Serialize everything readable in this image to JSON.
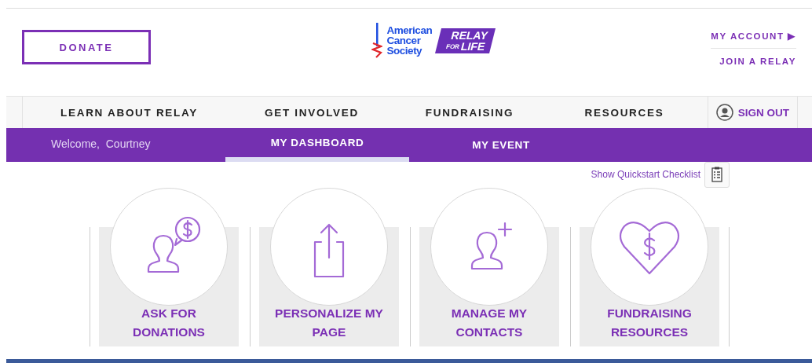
{
  "header": {
    "donate_button": "DONATE",
    "logo": {
      "org_lines": [
        "American",
        "Cancer",
        "Society"
      ],
      "badge_top": "RELAY",
      "badge_small": "FOR",
      "badge_bottom": "LIFE"
    },
    "account_links": [
      {
        "label": "MY ACCOUNT",
        "arrow": "▶"
      },
      {
        "label": "JOIN A RELAY"
      }
    ]
  },
  "nav": {
    "items": [
      "LEARN ABOUT RELAY",
      "GET INVOLVED",
      "FUNDRAISING",
      "RESOURCES"
    ],
    "sign_out": "SIGN OUT"
  },
  "subnav": {
    "welcome": "Welcome,  Courtney",
    "tabs": [
      {
        "label": "MY DASHBOARD",
        "selected": true
      },
      {
        "label": "MY EVENT",
        "selected": false
      }
    ]
  },
  "quickstart": {
    "label": "Show Quickstart Checklist"
  },
  "tiles": [
    {
      "kind": "ask",
      "lines": [
        "ASK FOR",
        "DONATIONS"
      ]
    },
    {
      "kind": "share",
      "lines": [
        "PERSONALIZE MY",
        "PAGE"
      ]
    },
    {
      "kind": "contact",
      "lines": [
        "MANAGE MY",
        "CONTACTS"
      ]
    },
    {
      "kind": "heart",
      "lines": [
        "FUNDRAISING",
        "RESOURCES"
      ]
    }
  ]
}
